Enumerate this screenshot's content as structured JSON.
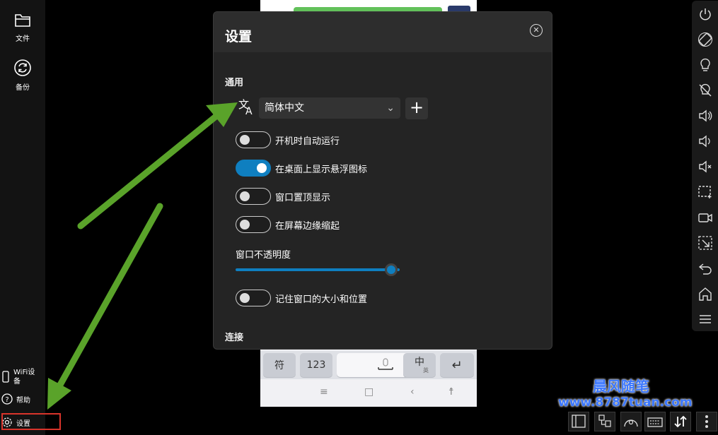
{
  "left_sidebar": {
    "files_label": "文件",
    "backup_label": "备份",
    "wifi_label_line1": "WiFi设",
    "wifi_label_line2": "备",
    "help_label": "帮助",
    "settings_label": "设置"
  },
  "dialog": {
    "title": "设置",
    "section_general": "通用",
    "language_value": "简体中文",
    "toggles": [
      {
        "label": "开机时自动运行",
        "on": false
      },
      {
        "label": "在桌面上显示悬浮图标",
        "on": true
      },
      {
        "label": "窗口置顶显示",
        "on": false
      },
      {
        "label": "在屏幕边缘缩起",
        "on": false
      }
    ],
    "opacity_label": "窗口不透明度",
    "opacity_value": 0.95,
    "remember_label": "记住窗口的大小和位置",
    "section_connect": "连接"
  },
  "keyboard": {
    "symbols": "符",
    "numbers": "123",
    "lang_main": "中",
    "lang_sub": "英",
    "enter": "↵"
  },
  "watermark": {
    "line1": "晨风随笔",
    "line2": "www.8787tuan.com"
  },
  "colors": {
    "accent": "#0f7fc0",
    "arrow": "#5aa32a",
    "highlight_box": "#d9342b"
  }
}
